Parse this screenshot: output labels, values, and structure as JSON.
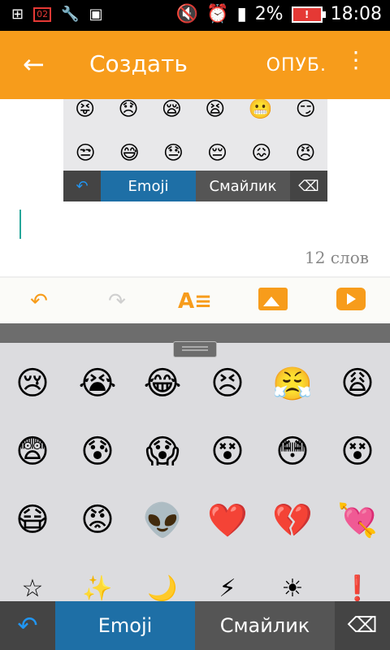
{
  "status": {
    "sim": "02",
    "battery": "2%",
    "time": "18:08"
  },
  "appbar": {
    "title": "Создать",
    "publish": "ОПУБ."
  },
  "preview": {
    "row1": [
      "😝",
      "😞",
      "😪",
      "😫",
      "😬",
      "😏"
    ],
    "row2": [
      "😒",
      "😅",
      "😓",
      "😔",
      "😖",
      "😠"
    ],
    "emoji_tab": "Emoji",
    "smiley_tab": "Смайлик"
  },
  "editor": {
    "word_count": "12 слов"
  },
  "keyboard": {
    "rows": [
      [
        "😢",
        "😭",
        "😂",
        "😣",
        "😤",
        "😩"
      ],
      [
        "😨",
        "😰",
        "😱",
        "😵",
        "😳",
        "😵"
      ],
      [
        "😷",
        "😡",
        "👽",
        "❤️",
        "💔",
        "💘"
      ],
      [
        "☆",
        "✨",
        "🌙",
        "⚡",
        "☀",
        "❗"
      ]
    ],
    "emoji_tab": "Emoji",
    "smiley_tab": "Смайлик"
  },
  "colors": {
    "accent": "#f79c1b",
    "tab_active": "#1e6fa6",
    "cursor": "#26a69a"
  }
}
